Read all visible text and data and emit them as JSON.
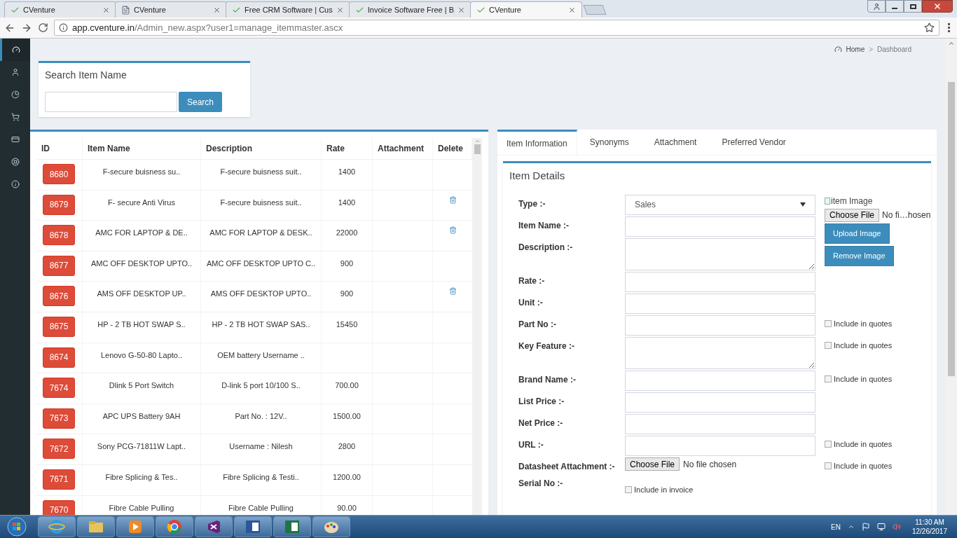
{
  "browser": {
    "tabs": [
      {
        "title": "CVenture",
        "selected": false
      },
      {
        "title": "CVenture",
        "selected": false
      },
      {
        "title": "Free CRM Software | Cus",
        "selected": false
      },
      {
        "title": "Invoice Software Free | B",
        "selected": false
      },
      {
        "title": "CVenture",
        "selected": true
      }
    ],
    "url_host": "app.cventure.in",
    "url_path": "/Admin_new.aspx?user1=manage_itemmaster.ascx"
  },
  "sidebar": {
    "items": [
      {
        "selected": true
      },
      {
        "selected": false
      },
      {
        "selected": false
      },
      {
        "selected": false
      },
      {
        "selected": false
      },
      {
        "selected": false
      },
      {
        "selected": false
      }
    ]
  },
  "breadcrumb": {
    "items": [
      "Home",
      "Dashboard"
    ],
    "separator": ">"
  },
  "search": {
    "title": "Search Item Name",
    "button": "Search"
  },
  "table": {
    "columns": [
      "ID",
      "Item Name",
      "Description",
      "Rate",
      "Attachment",
      "Delete"
    ],
    "rows": [
      {
        "id": "8680",
        "name": "F-secure buisness su..",
        "description": "F-secure buisness suit..",
        "rate": "1400",
        "deletable": false
      },
      {
        "id": "8679",
        "name": "F- secure Anti Virus",
        "description": "F-secure buisness suit..",
        "rate": "1400",
        "deletable": true
      },
      {
        "id": "8678",
        "name": "AMC FOR LAPTOP & DE..",
        "description": "AMC FOR LAPTOP & DESK..",
        "rate": "22000",
        "deletable": true
      },
      {
        "id": "8677",
        "name": "AMC OFF DESKTOP UPTO..",
        "description": "AMC OFF DESKTOP UPTO C..",
        "rate": "900",
        "deletable": false
      },
      {
        "id": "8676",
        "name": "AMS OFF DESKTOP UP..",
        "description": "AMS OFF DESKTOP UPTO..",
        "rate": "900",
        "deletable": true
      },
      {
        "id": "8675",
        "name": "HP - 2 TB HOT SWAP S..",
        "description": "HP - 2 TB HOT SWAP SAS..",
        "rate": "15450",
        "deletable": false
      },
      {
        "id": "8674",
        "name": "Lenovo G-50-80 Lapto..",
        "description": "OEM battery Username ..",
        "rate": "",
        "deletable": false
      },
      {
        "id": "7674",
        "name": "Dlink 5 Port Switch",
        "description": "D-link 5 port 10/100 S..",
        "rate": "700.00",
        "deletable": false
      },
      {
        "id": "7673",
        "name": "APC UPS Battery 9AH",
        "description": "Part No. : 12V..",
        "rate": "1500.00",
        "deletable": false
      },
      {
        "id": "7672",
        "name": "Sony PCG-71811W Lapt..",
        "description": "Username : Nilesh",
        "rate": "2800",
        "deletable": false
      },
      {
        "id": "7671",
        "name": "Fibre Splicing & Tes..",
        "description": "Fibre Splicing & Testi..",
        "rate": "1200.00",
        "deletable": false
      },
      {
        "id": "7670",
        "name": "Fibre Cable Pulling",
        "description": "Fibre Cable Pulling",
        "rate": "90.00",
        "deletable": false
      }
    ]
  },
  "detail_tabs": [
    {
      "label": "Item Information",
      "selected": true
    },
    {
      "label": "Synonyms",
      "selected": false
    },
    {
      "label": "Attachment",
      "selected": false
    },
    {
      "label": "Preferred Vendor",
      "selected": false
    }
  ],
  "item_details": {
    "title": "Item Details",
    "image": {
      "alt": "item Image",
      "choose": "Choose File",
      "file": "No fi…hosen",
      "upload": "Upload Image",
      "remove": "Remove Image"
    },
    "fields": [
      {
        "label": "Type :-",
        "kind": "select",
        "value": "Sales"
      },
      {
        "label": "Item Name :-",
        "kind": "text"
      },
      {
        "label": "Description :-",
        "kind": "textarea"
      },
      {
        "label": "Rate :-",
        "kind": "text"
      },
      {
        "label": "Unit :-",
        "kind": "text"
      },
      {
        "label": "Part No :-",
        "kind": "text",
        "option": {
          "label": "Include in quotes",
          "checked": false
        }
      },
      {
        "label": "Key Feature :-",
        "kind": "textarea",
        "option": {
          "label": "Include in quotes",
          "checked": false
        }
      },
      {
        "label": "Brand Name :-",
        "kind": "text",
        "option": {
          "label": "Include in quotes",
          "checked": false
        }
      },
      {
        "label": "List Price :-",
        "kind": "text"
      },
      {
        "label": "Net Price :-",
        "kind": "text"
      },
      {
        "label": "URL :-",
        "kind": "text",
        "option": {
          "label": "Include in quotes",
          "checked": false
        }
      },
      {
        "label": "Datasheet Attachment :-",
        "kind": "file",
        "choose": "Choose File",
        "file": "No file chosen",
        "option": {
          "label": "Include in quotes",
          "checked": false
        }
      },
      {
        "label": "Serial No :-",
        "kind": "checkbox",
        "option": {
          "label": "Include in invoice",
          "checked": false
        }
      }
    ]
  },
  "taskbar": {
    "language": "EN",
    "time": "11:30 AM",
    "date": "12/26/2017"
  }
}
